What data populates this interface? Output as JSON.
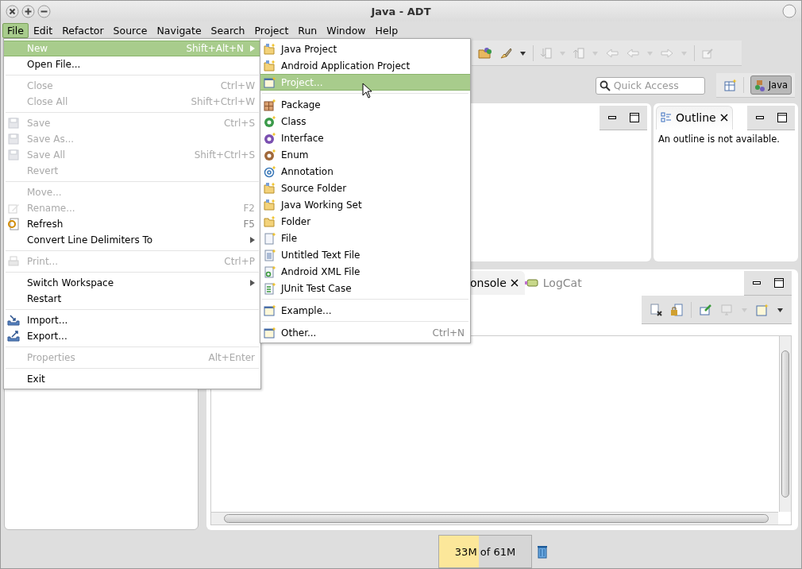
{
  "window": {
    "title": "Java - ADT"
  },
  "menu_bar": [
    {
      "label": "File",
      "selected": true
    },
    {
      "label": "Edit",
      "selected": false
    },
    {
      "label": "Refactor",
      "selected": false
    },
    {
      "label": "Source",
      "selected": false
    },
    {
      "label": "Navigate",
      "selected": false
    },
    {
      "label": "Search",
      "selected": false
    },
    {
      "label": "Project",
      "selected": false
    },
    {
      "label": "Run",
      "selected": false
    },
    {
      "label": "Window",
      "selected": false
    },
    {
      "label": "Help",
      "selected": false
    }
  ],
  "file_menu": [
    {
      "kind": "item",
      "label": "New",
      "shortcut": "Shift+Alt+N",
      "submenu": true,
      "disabled": false,
      "selected": true
    },
    {
      "kind": "item",
      "label": "Open File...",
      "disabled": false,
      "selected": false
    },
    {
      "kind": "separator"
    },
    {
      "kind": "item",
      "label": "Close",
      "shortcut": "Ctrl+W",
      "disabled": true,
      "selected": false
    },
    {
      "kind": "item",
      "label": "Close All",
      "shortcut": "Shift+Ctrl+W",
      "disabled": true,
      "selected": false
    },
    {
      "kind": "separator"
    },
    {
      "kind": "item",
      "label": "Save",
      "shortcut": "Ctrl+S",
      "disabled": true,
      "selected": false
    },
    {
      "kind": "item",
      "label": "Save As...",
      "disabled": true,
      "selected": false
    },
    {
      "kind": "item",
      "label": "Save All",
      "shortcut": "Shift+Ctrl+S",
      "disabled": true,
      "selected": false
    },
    {
      "kind": "item",
      "label": "Revert",
      "disabled": true,
      "selected": false
    },
    {
      "kind": "separator"
    },
    {
      "kind": "item",
      "label": "Move...",
      "disabled": true,
      "selected": false
    },
    {
      "kind": "item",
      "label": "Rename...",
      "shortcut": "F2",
      "disabled": true,
      "selected": false
    },
    {
      "kind": "item",
      "label": "Refresh",
      "shortcut": "F5",
      "disabled": false,
      "selected": false
    },
    {
      "kind": "item",
      "label": "Convert Line Delimiters To",
      "submenu": true,
      "disabled": false,
      "selected": false
    },
    {
      "kind": "separator"
    },
    {
      "kind": "item",
      "label": "Print...",
      "shortcut": "Ctrl+P",
      "disabled": true,
      "selected": false
    },
    {
      "kind": "separator"
    },
    {
      "kind": "item",
      "label": "Switch Workspace",
      "submenu": true,
      "disabled": false,
      "selected": false
    },
    {
      "kind": "item",
      "label": "Restart",
      "disabled": false,
      "selected": false
    },
    {
      "kind": "separator"
    },
    {
      "kind": "item",
      "label": "Import...",
      "disabled": false,
      "selected": false
    },
    {
      "kind": "item",
      "label": "Export...",
      "disabled": false,
      "selected": false
    },
    {
      "kind": "separator"
    },
    {
      "kind": "item",
      "label": "Properties",
      "shortcut": "Alt+Enter",
      "disabled": true,
      "selected": false
    },
    {
      "kind": "separator"
    },
    {
      "kind": "item",
      "label": "Exit",
      "disabled": false,
      "selected": false
    }
  ],
  "new_submenu": [
    {
      "kind": "item",
      "label": "Java Project",
      "selected": false
    },
    {
      "kind": "item",
      "label": "Android Application Project",
      "selected": false
    },
    {
      "kind": "item",
      "label": "Project...",
      "selected": true
    },
    {
      "kind": "separator"
    },
    {
      "kind": "item",
      "label": "Package",
      "selected": false
    },
    {
      "kind": "item",
      "label": "Class",
      "selected": false
    },
    {
      "kind": "item",
      "label": "Interface",
      "selected": false
    },
    {
      "kind": "item",
      "label": "Enum",
      "selected": false
    },
    {
      "kind": "item",
      "label": "Annotation",
      "selected": false
    },
    {
      "kind": "item",
      "label": "Source Folder",
      "selected": false
    },
    {
      "kind": "item",
      "label": "Java Working Set",
      "selected": false
    },
    {
      "kind": "item",
      "label": "Folder",
      "selected": false
    },
    {
      "kind": "item",
      "label": "File",
      "selected": false
    },
    {
      "kind": "item",
      "label": "Untitled Text File",
      "selected": false
    },
    {
      "kind": "item",
      "label": "Android XML File",
      "selected": false
    },
    {
      "kind": "item",
      "label": "JUnit Test Case",
      "selected": false
    },
    {
      "kind": "separator"
    },
    {
      "kind": "item",
      "label": "Example...",
      "selected": false
    },
    {
      "kind": "separator"
    },
    {
      "kind": "item",
      "label": "Other...",
      "shortcut": "Ctrl+N",
      "selected": false
    }
  ],
  "quick_access": {
    "placeholder": "Quick Access"
  },
  "perspectives": [
    {
      "label": "Java",
      "selected": true
    }
  ],
  "outline": {
    "tab": "Outline",
    "message": "An outline is not available."
  },
  "console_tabs": [
    {
      "label": "onsole",
      "selected": true
    },
    {
      "label": "LogCat",
      "selected": false
    }
  ],
  "heap": {
    "text": "33M of 61M",
    "level": 0.43
  }
}
